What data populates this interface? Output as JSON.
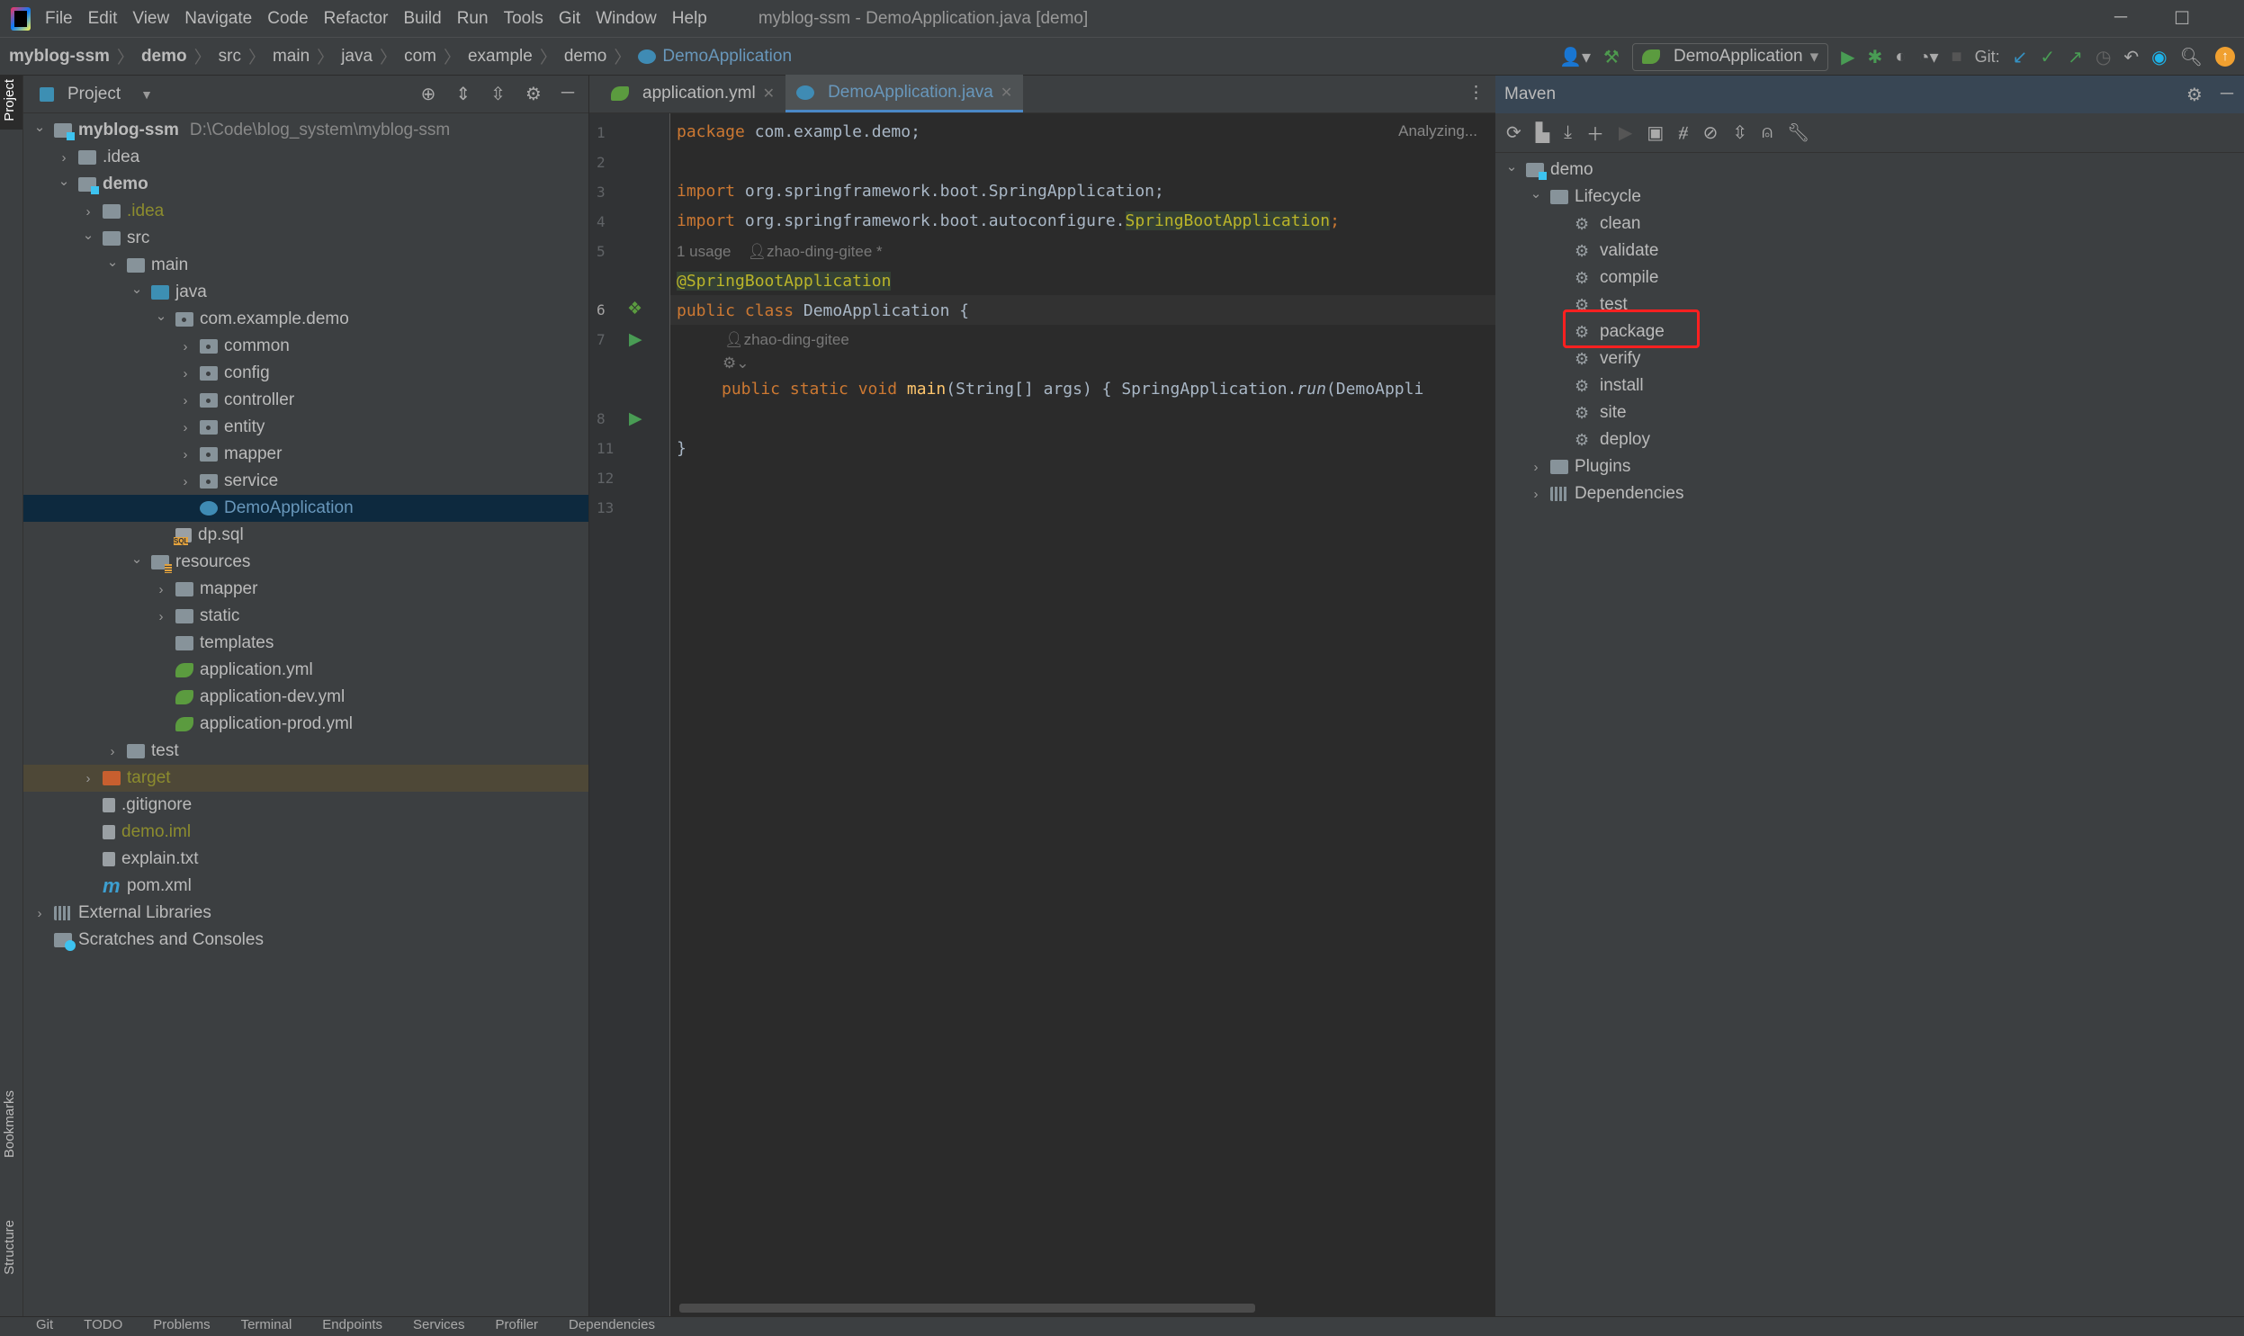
{
  "titlebar": {
    "menu": [
      "File",
      "Edit",
      "View",
      "Navigate",
      "Code",
      "Refactor",
      "Build",
      "Run",
      "Tools",
      "Git",
      "Window",
      "Help"
    ],
    "title": "myblog-ssm - DemoApplication.java [demo]"
  },
  "breadcrumb": [
    "myblog-ssm",
    "demo",
    "src",
    "main",
    "java",
    "com",
    "example",
    "demo",
    "DemoApplication"
  ],
  "toolbar": {
    "run_config": "DemoApplication",
    "git_label": "Git:"
  },
  "left_stripe": {
    "project": "Project",
    "bookmarks": "Bookmarks",
    "structure": "Structure"
  },
  "project": {
    "title": "Project",
    "tree": [
      {
        "label": "myblog-ssm",
        "depth": 0,
        "arrow": "down",
        "icon": "module",
        "bold": true,
        "path": "D:\\Code\\blog_system\\myblog-ssm"
      },
      {
        "label": ".idea",
        "depth": 1,
        "arrow": "right",
        "icon": "folder"
      },
      {
        "label": "demo",
        "depth": 1,
        "arrow": "down",
        "icon": "module",
        "bold": true
      },
      {
        "label": ".idea",
        "depth": 2,
        "arrow": "right",
        "icon": "folder",
        "color": "#8c8c2e"
      },
      {
        "label": "src",
        "depth": 2,
        "arrow": "down",
        "icon": "folder"
      },
      {
        "label": "main",
        "depth": 3,
        "arrow": "down",
        "icon": "folder"
      },
      {
        "label": "java",
        "depth": 4,
        "arrow": "down",
        "icon": "srcfolder"
      },
      {
        "label": "com.example.demo",
        "depth": 5,
        "arrow": "down",
        "icon": "pkg"
      },
      {
        "label": "common",
        "depth": 6,
        "arrow": "right",
        "icon": "pkg"
      },
      {
        "label": "config",
        "depth": 6,
        "arrow": "right",
        "icon": "pkg"
      },
      {
        "label": "controller",
        "depth": 6,
        "arrow": "right",
        "icon": "pkg"
      },
      {
        "label": "entity",
        "depth": 6,
        "arrow": "right",
        "icon": "pkg"
      },
      {
        "label": "mapper",
        "depth": 6,
        "arrow": "right",
        "icon": "pkg"
      },
      {
        "label": "service",
        "depth": 6,
        "arrow": "right",
        "icon": "pkg"
      },
      {
        "label": "DemoApplication",
        "depth": 6,
        "arrow": "",
        "icon": "java",
        "selected": true,
        "color": "#6897bb"
      },
      {
        "label": "dp.sql",
        "depth": 5,
        "arrow": "",
        "icon": "sql"
      },
      {
        "label": "resources",
        "depth": 4,
        "arrow": "down",
        "icon": "res"
      },
      {
        "label": "mapper",
        "depth": 5,
        "arrow": "right",
        "icon": "folder"
      },
      {
        "label": "static",
        "depth": 5,
        "arrow": "right",
        "icon": "folder"
      },
      {
        "label": "templates",
        "depth": 5,
        "arrow": "",
        "icon": "folder"
      },
      {
        "label": "application.yml",
        "depth": 5,
        "arrow": "",
        "icon": "spring"
      },
      {
        "label": "application-dev.yml",
        "depth": 5,
        "arrow": "",
        "icon": "spring"
      },
      {
        "label": "application-prod.yml",
        "depth": 5,
        "arrow": "",
        "icon": "spring"
      },
      {
        "label": "test",
        "depth": 3,
        "arrow": "right",
        "icon": "folder"
      },
      {
        "label": "target",
        "depth": 2,
        "arrow": "right",
        "icon": "target",
        "highlight": true,
        "color": "#8c8c2e"
      },
      {
        "label": ".gitignore",
        "depth": 2,
        "arrow": "",
        "icon": "file"
      },
      {
        "label": "demo.iml",
        "depth": 2,
        "arrow": "",
        "icon": "file",
        "color": "#8c8c2e"
      },
      {
        "label": "explain.txt",
        "depth": 2,
        "arrow": "",
        "icon": "file"
      },
      {
        "label": "pom.xml",
        "depth": 2,
        "arrow": "",
        "icon": "maven"
      },
      {
        "label": "External Libraries",
        "depth": 0,
        "arrow": "right",
        "icon": "libs"
      },
      {
        "label": "Scratches and Consoles",
        "depth": 0,
        "arrow": "",
        "icon": "scratch"
      }
    ]
  },
  "editor": {
    "tabs": [
      {
        "label": "application.yml",
        "active": false
      },
      {
        "label": "DemoApplication.java",
        "active": true
      }
    ],
    "status": "Analyzing...",
    "line_numbers": [
      "1",
      "2",
      "3",
      "4",
      "5",
      "6",
      "7",
      "8",
      "11",
      "12",
      "13"
    ],
    "code": {
      "l1_kw": "package",
      "l1_rest": " com.example.demo;",
      "l3_kw": "import",
      "l3_rest": " org.springframework.boot.SpringApplication;",
      "l4_kw": "import",
      "l4_mid": " org.springframework.boot.autoconfigure.",
      "l4_hl": "SpringBootApplication",
      "l4_end": ";",
      "usage_hint": "1 usage",
      "author_hint": "zhao-ding-gitee *",
      "l6": "@SpringBootApplication",
      "l7_kw": "public class",
      "l7_rest": " DemoApplication {",
      "author_hint2": "zhao-ding-gitee",
      "l8_kw": "public static void",
      "l8_fn": " main",
      "l8_rest": "(String[] args) { SpringApplication.",
      "l8_run": "run",
      "l8_end": "(DemoAppli",
      "l12": "}"
    }
  },
  "maven": {
    "title": "Maven",
    "root": "demo",
    "lifecycle": "Lifecycle",
    "goals": [
      "clean",
      "validate",
      "compile",
      "test",
      "package",
      "verify",
      "install",
      "site",
      "deploy"
    ],
    "highlighted_goal": "package",
    "plugins": "Plugins",
    "dependencies": "Dependencies"
  },
  "bottom_tabs": [
    "Git",
    "TODO",
    "Problems",
    "Terminal",
    "Endpoints",
    "Services",
    "Profiler",
    "Dependencies"
  ]
}
